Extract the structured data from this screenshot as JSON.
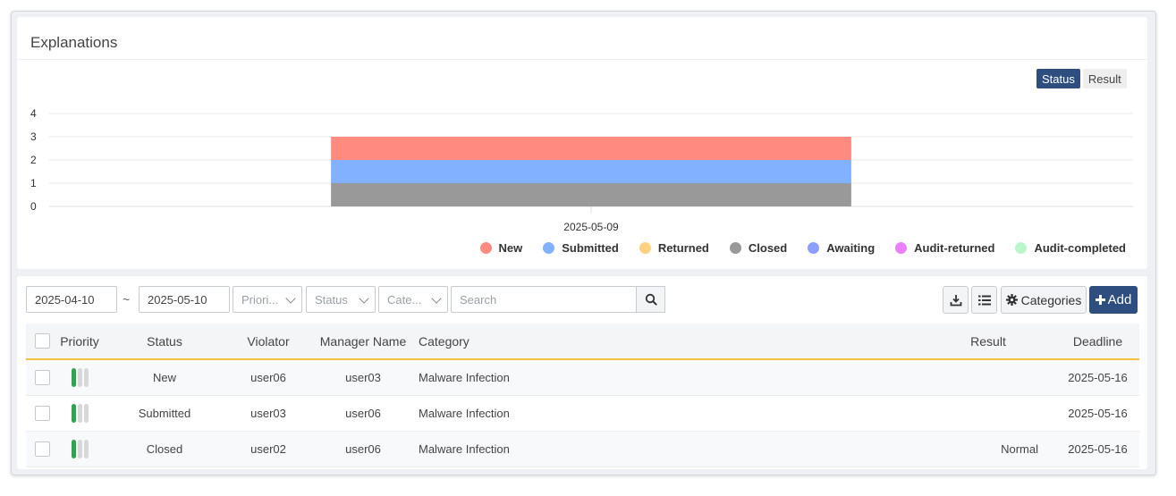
{
  "panel": {
    "title": "Explanations"
  },
  "toggle": {
    "status": "Status",
    "result": "Result"
  },
  "chart_data": {
    "type": "bar",
    "stacked": true,
    "categories": [
      "2025-05-09"
    ],
    "series": [
      {
        "name": "New",
        "color": "#ff8a80",
        "values": [
          1
        ]
      },
      {
        "name": "Submitted",
        "color": "#82b1ff",
        "values": [
          1
        ]
      },
      {
        "name": "Returned",
        "color": "#ffd180",
        "values": [
          0
        ]
      },
      {
        "name": "Closed",
        "color": "#999999",
        "values": [
          1
        ]
      },
      {
        "name": "Awaiting",
        "color": "#8c9eff",
        "values": [
          0
        ]
      },
      {
        "name": "Audit-returned",
        "color": "#ea80fc",
        "values": [
          0
        ]
      },
      {
        "name": "Audit-completed",
        "color": "#b9f6ca",
        "values": [
          0
        ]
      }
    ],
    "stack_order": [
      "Closed",
      "Submitted",
      "New"
    ],
    "ylim": [
      0,
      4
    ],
    "yticks": [
      0,
      1,
      2,
      3,
      4
    ],
    "grid": true,
    "legend": "bottom-right"
  },
  "filters": {
    "date_from": "2025-04-10",
    "separator": "~",
    "date_to": "2025-05-10",
    "priority_placeholder": "Priori...",
    "status_placeholder": "Status",
    "category_placeholder": "Cate...",
    "search_placeholder": "Search"
  },
  "toolbar": {
    "categories_label": "Categories",
    "add_label": "Add"
  },
  "icons": {
    "search": "search-icon",
    "download": "download-icon",
    "list": "list-icon",
    "gear": "gear-icon",
    "plus": "plus-icon"
  },
  "table": {
    "headers": {
      "priority": "Priority",
      "status": "Status",
      "violator": "Violator",
      "manager": "Manager Name",
      "category": "Category",
      "result": "Result",
      "deadline": "Deadline"
    },
    "rows": [
      {
        "priority_level": 1,
        "status": "New",
        "violator": "user06",
        "manager": "user03",
        "category": "Malware Infection",
        "result": "",
        "deadline": "2025-05-16"
      },
      {
        "priority_level": 1,
        "status": "Submitted",
        "violator": "user03",
        "manager": "user06",
        "category": "Malware Infection",
        "result": "",
        "deadline": "2025-05-16"
      },
      {
        "priority_level": 1,
        "status": "Closed",
        "violator": "user02",
        "manager": "user06",
        "category": "Malware Infection",
        "result": "Normal",
        "deadline": "2025-05-16"
      }
    ]
  }
}
